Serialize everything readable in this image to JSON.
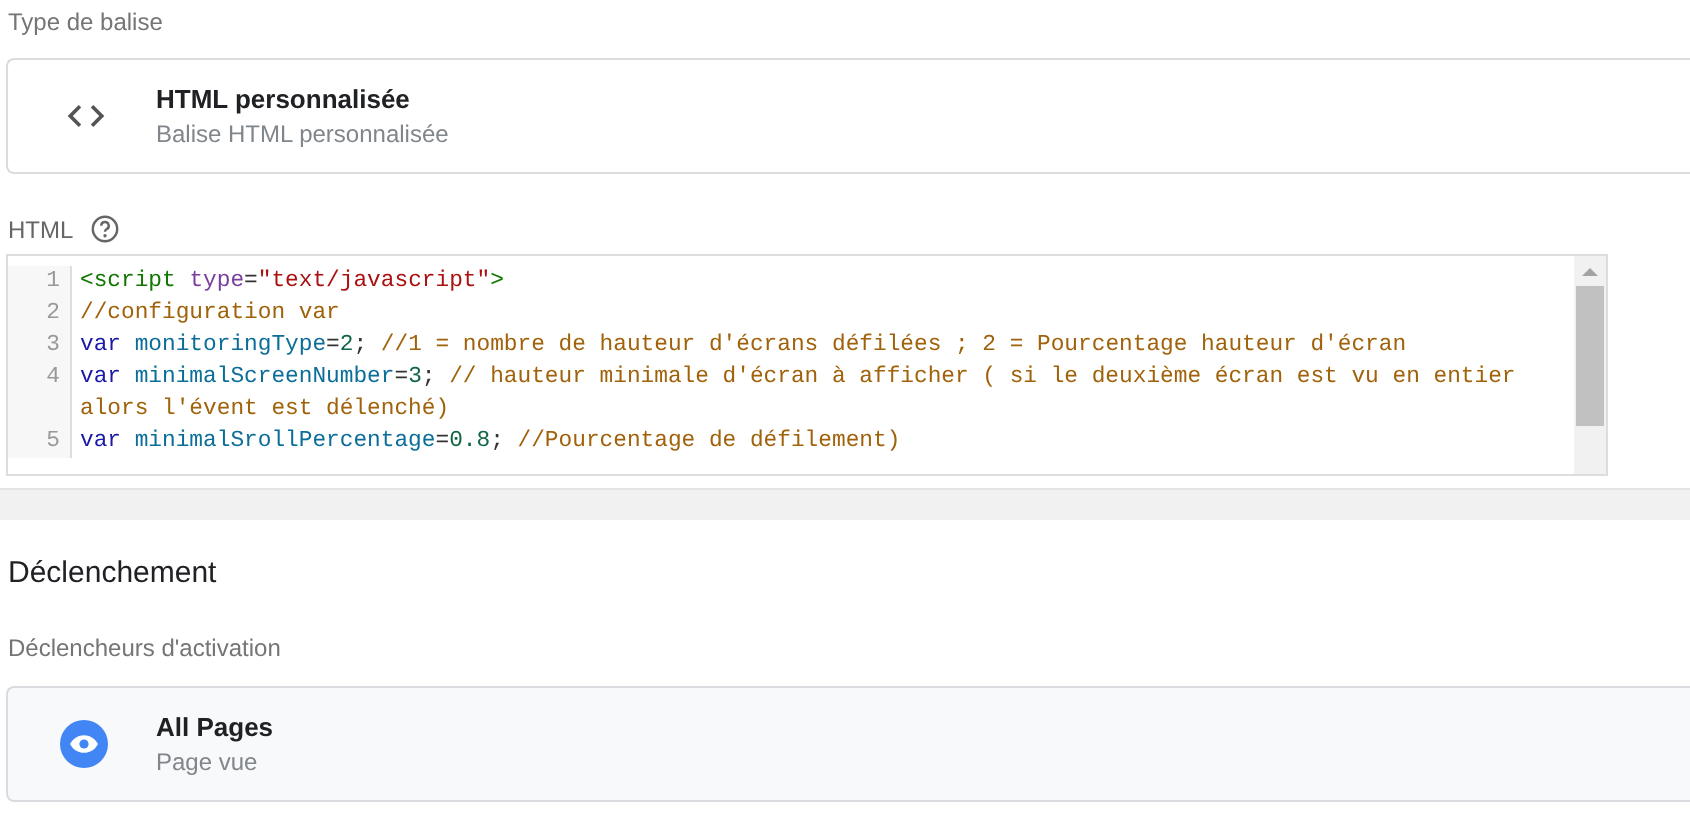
{
  "tag_type": {
    "label": "Type de balise",
    "card": {
      "title": "HTML personnalisée",
      "subtitle": "Balise HTML personnalisée"
    }
  },
  "html": {
    "label": "HTML",
    "code_lines": [
      {
        "number": "1",
        "tokens": [
          {
            "kind": "tag",
            "text": "<script "
          },
          {
            "kind": "attr",
            "text": "type"
          },
          {
            "kind": "plain",
            "text": "="
          },
          {
            "kind": "string",
            "text": "\"text/javascript\""
          },
          {
            "kind": "tag",
            "text": ">"
          }
        ]
      },
      {
        "number": "2",
        "tokens": [
          {
            "kind": "comment",
            "text": "//configuration var"
          }
        ]
      },
      {
        "number": "3",
        "tokens": [
          {
            "kind": "keyword",
            "text": "var "
          },
          {
            "kind": "variable",
            "text": "monitoringType"
          },
          {
            "kind": "plain",
            "text": "="
          },
          {
            "kind": "number",
            "text": "2"
          },
          {
            "kind": "plain",
            "text": "; "
          },
          {
            "kind": "comment",
            "text": "//1 = nombre de hauteur d'écrans défilées ; 2 = Pourcentage hauteur d'écran"
          }
        ]
      },
      {
        "number": "4",
        "tokens": [
          {
            "kind": "keyword",
            "text": "var "
          },
          {
            "kind": "variable",
            "text": "minimalScreenNumber"
          },
          {
            "kind": "plain",
            "text": "="
          },
          {
            "kind": "number",
            "text": "3"
          },
          {
            "kind": "plain",
            "text": "; "
          },
          {
            "kind": "comment",
            "text": "// hauteur minimale d'écran à afficher ( si le deuxième écran est vu en entier alors l'évent est délenché)"
          }
        ]
      },
      {
        "number": "5",
        "tokens": [
          {
            "kind": "keyword",
            "text": "var "
          },
          {
            "kind": "variable",
            "text": "minimalSrollPercentage"
          },
          {
            "kind": "plain",
            "text": "="
          },
          {
            "kind": "number",
            "text": "0.8"
          },
          {
            "kind": "plain",
            "text": "; "
          },
          {
            "kind": "comment",
            "text": "//Pourcentage de défilement)"
          }
        ]
      }
    ]
  },
  "triggering": {
    "title": "Déclenchement",
    "label": "Déclencheurs d'activation",
    "card": {
      "title": "All Pages",
      "subtitle": "Page vue"
    }
  }
}
